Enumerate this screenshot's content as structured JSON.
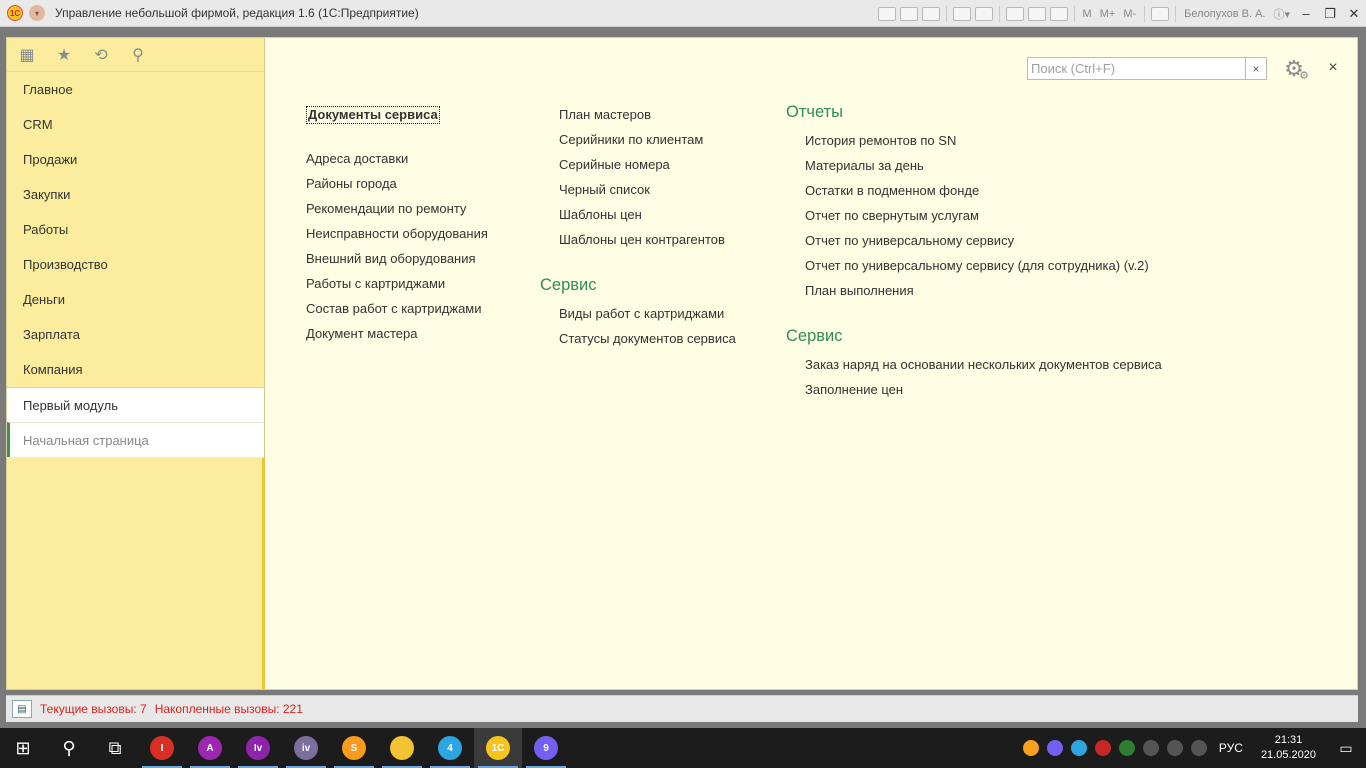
{
  "window": {
    "title": "Управление небольшой фирмой, редакция 1.6  (1С:Предприятие)",
    "logo_text": "1C",
    "user": "Белопухов В. А.",
    "toolbar_memory": [
      "M",
      "M+",
      "M-"
    ]
  },
  "sidebar": {
    "items": [
      {
        "label": "Главное"
      },
      {
        "label": "CRM"
      },
      {
        "label": "Продажи"
      },
      {
        "label": "Закупки"
      },
      {
        "label": "Работы"
      },
      {
        "label": "Производство"
      },
      {
        "label": "Деньги"
      },
      {
        "label": "Зарплата"
      },
      {
        "label": "Компания"
      },
      {
        "label": "Первый модуль"
      }
    ],
    "open_page": "Начальная страница"
  },
  "search": {
    "placeholder": "Поиск (Ctrl+F)",
    "value": "",
    "clear": "×"
  },
  "close_symbol": "×",
  "content": {
    "col1": {
      "items": [
        "Документы сервиса",
        "Адреса доставки",
        "Районы города",
        "Рекомендации по ремонту",
        "Неисправности оборудования",
        "Внешний вид оборудования",
        "Работы с картриджами",
        "Состав работ с картриджами",
        "Документ мастера"
      ]
    },
    "col2": {
      "items": [
        "План мастеров",
        "Серийники по клиентам",
        "Серийные номера",
        "Черный список",
        "Шаблоны цен",
        "Шаблоны цен контрагентов"
      ],
      "group_title": "Сервис",
      "group_items": [
        "Виды работ с картриджами",
        "Статусы документов сервиса"
      ]
    },
    "col3": {
      "reports_title": "Отчеты",
      "reports": [
        "История ремонтов по SN",
        "Материалы за день",
        "Остатки в подменном фонде",
        "Отчет по свернутым услугам",
        "Отчет по универсальному сервису",
        "Отчет по универсальному сервису (для сотрудника) (v.2)",
        "План выполнения"
      ],
      "service_title": "Сервис",
      "service": [
        "Заказ наряд на основании нескольких документов сервиса",
        "Заполнение цен"
      ]
    }
  },
  "status": {
    "current": "Текущие вызовы: 7",
    "accumulated": "Накопленные вызовы: 221"
  },
  "taskbar": {
    "apps": [
      {
        "name": "chrome-profile-i",
        "badge": "I",
        "color": "#d93025"
      },
      {
        "name": "chrome-profile-a",
        "badge": "A",
        "color": "#9c27b0"
      },
      {
        "name": "chrome-profile-iv",
        "badge": "Iv",
        "color": "#8e24aa"
      },
      {
        "name": "chrome-profile-iv2",
        "badge": "iv",
        "color": "#7b6f9e"
      },
      {
        "name": "sublime",
        "badge": "S",
        "color": "#f79a1e"
      },
      {
        "name": "explorer",
        "badge": "",
        "color": "#f1c232"
      },
      {
        "name": "telegram",
        "badge": "4",
        "color": "#2ca5e0"
      },
      {
        "name": "1c",
        "badge": "1C",
        "color": "#f6c51b"
      },
      {
        "name": "viber",
        "badge": "9",
        "color": "#7360f2"
      }
    ],
    "lang": "РУС",
    "time": "21:31",
    "date": "21.05.2020"
  },
  "colors": {
    "accent_green": "#2e8f55",
    "sidebar_bg": "#fbec9e",
    "content_bg": "#fffde3",
    "status_red": "#d9231b"
  }
}
